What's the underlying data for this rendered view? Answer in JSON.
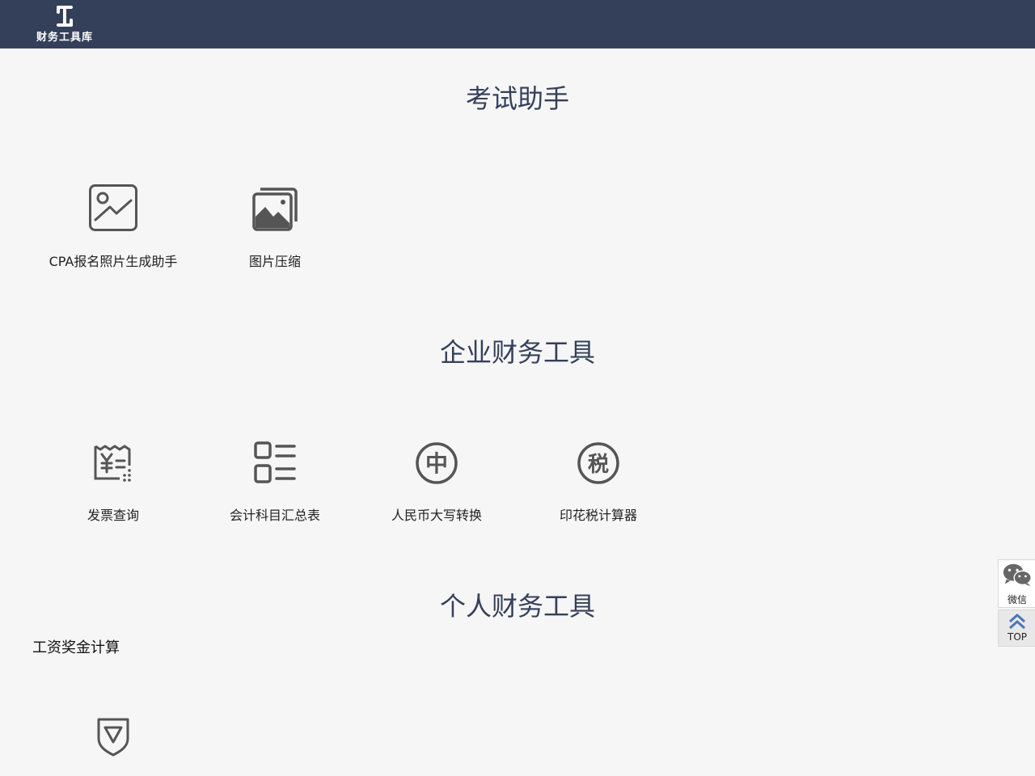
{
  "header": {
    "logo_text": "财务工具库",
    "logo_mark": "工"
  },
  "sections": [
    {
      "title": "考试助手",
      "tools": [
        {
          "label": "CPA报名照片生成助手",
          "icon": "chart-line-icon"
        },
        {
          "label": "图片压缩",
          "icon": "image-icon"
        }
      ]
    },
    {
      "title": "企业财务工具",
      "tools": [
        {
          "label": "发票查询",
          "icon": "invoice-icon"
        },
        {
          "label": "会计科目汇总表",
          "icon": "list-icon"
        },
        {
          "label": "人民币大写转换",
          "icon": "zhong-circle-icon",
          "glyph": "中"
        },
        {
          "label": "印花税计算器",
          "icon": "tax-circle-icon",
          "glyph": "税"
        }
      ]
    },
    {
      "title": "个人财务工具",
      "subsection": "工资奖金计算",
      "tools": [
        {
          "label": "",
          "icon": "shield-icon"
        }
      ]
    }
  ],
  "side": {
    "wechat_label": "微信",
    "top_label": "TOP"
  },
  "colors": {
    "header_bg": "#34405a",
    "page_bg": "#f6f6f6",
    "icon": "#555555",
    "title": "#34405a"
  }
}
